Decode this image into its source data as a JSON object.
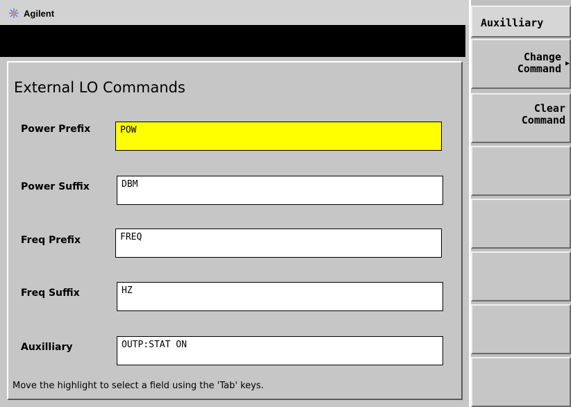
{
  "header": {
    "brand": "Agilent"
  },
  "dialog": {
    "title": "External LO Commands",
    "fields": [
      {
        "label": "Power Prefix",
        "value": "POW",
        "active": true
      },
      {
        "label": "Power Suffix",
        "value": " DBM",
        "active": false
      },
      {
        "label": "Freq Prefix",
        "value": "FREQ",
        "active": false
      },
      {
        "label": "Freq Suffix",
        "value": " HZ",
        "active": false
      },
      {
        "label": "Auxilliary",
        "value": "OUTP:STAT ON",
        "active": false
      }
    ],
    "status": "Move the highlight to select a field using the 'Tab' keys."
  },
  "softkeys": {
    "menu_title": "Auxilliary",
    "keys": [
      {
        "label": "Change\nCommand",
        "has_arrow": true
      },
      {
        "label": "Clear\nCommand",
        "has_arrow": false
      },
      {
        "label": "",
        "has_arrow": false
      },
      {
        "label": "",
        "has_arrow": false
      },
      {
        "label": "",
        "has_arrow": false
      },
      {
        "label": "",
        "has_arrow": false
      },
      {
        "label": "",
        "has_arrow": false
      }
    ]
  },
  "colors": {
    "highlight": "#ffff00",
    "background": "#c6c6c6",
    "display_bar": "#000000"
  },
  "icons": {
    "brand_logo": "agilent-spark-icon",
    "submenu_arrow": "triangle-right-icon"
  }
}
